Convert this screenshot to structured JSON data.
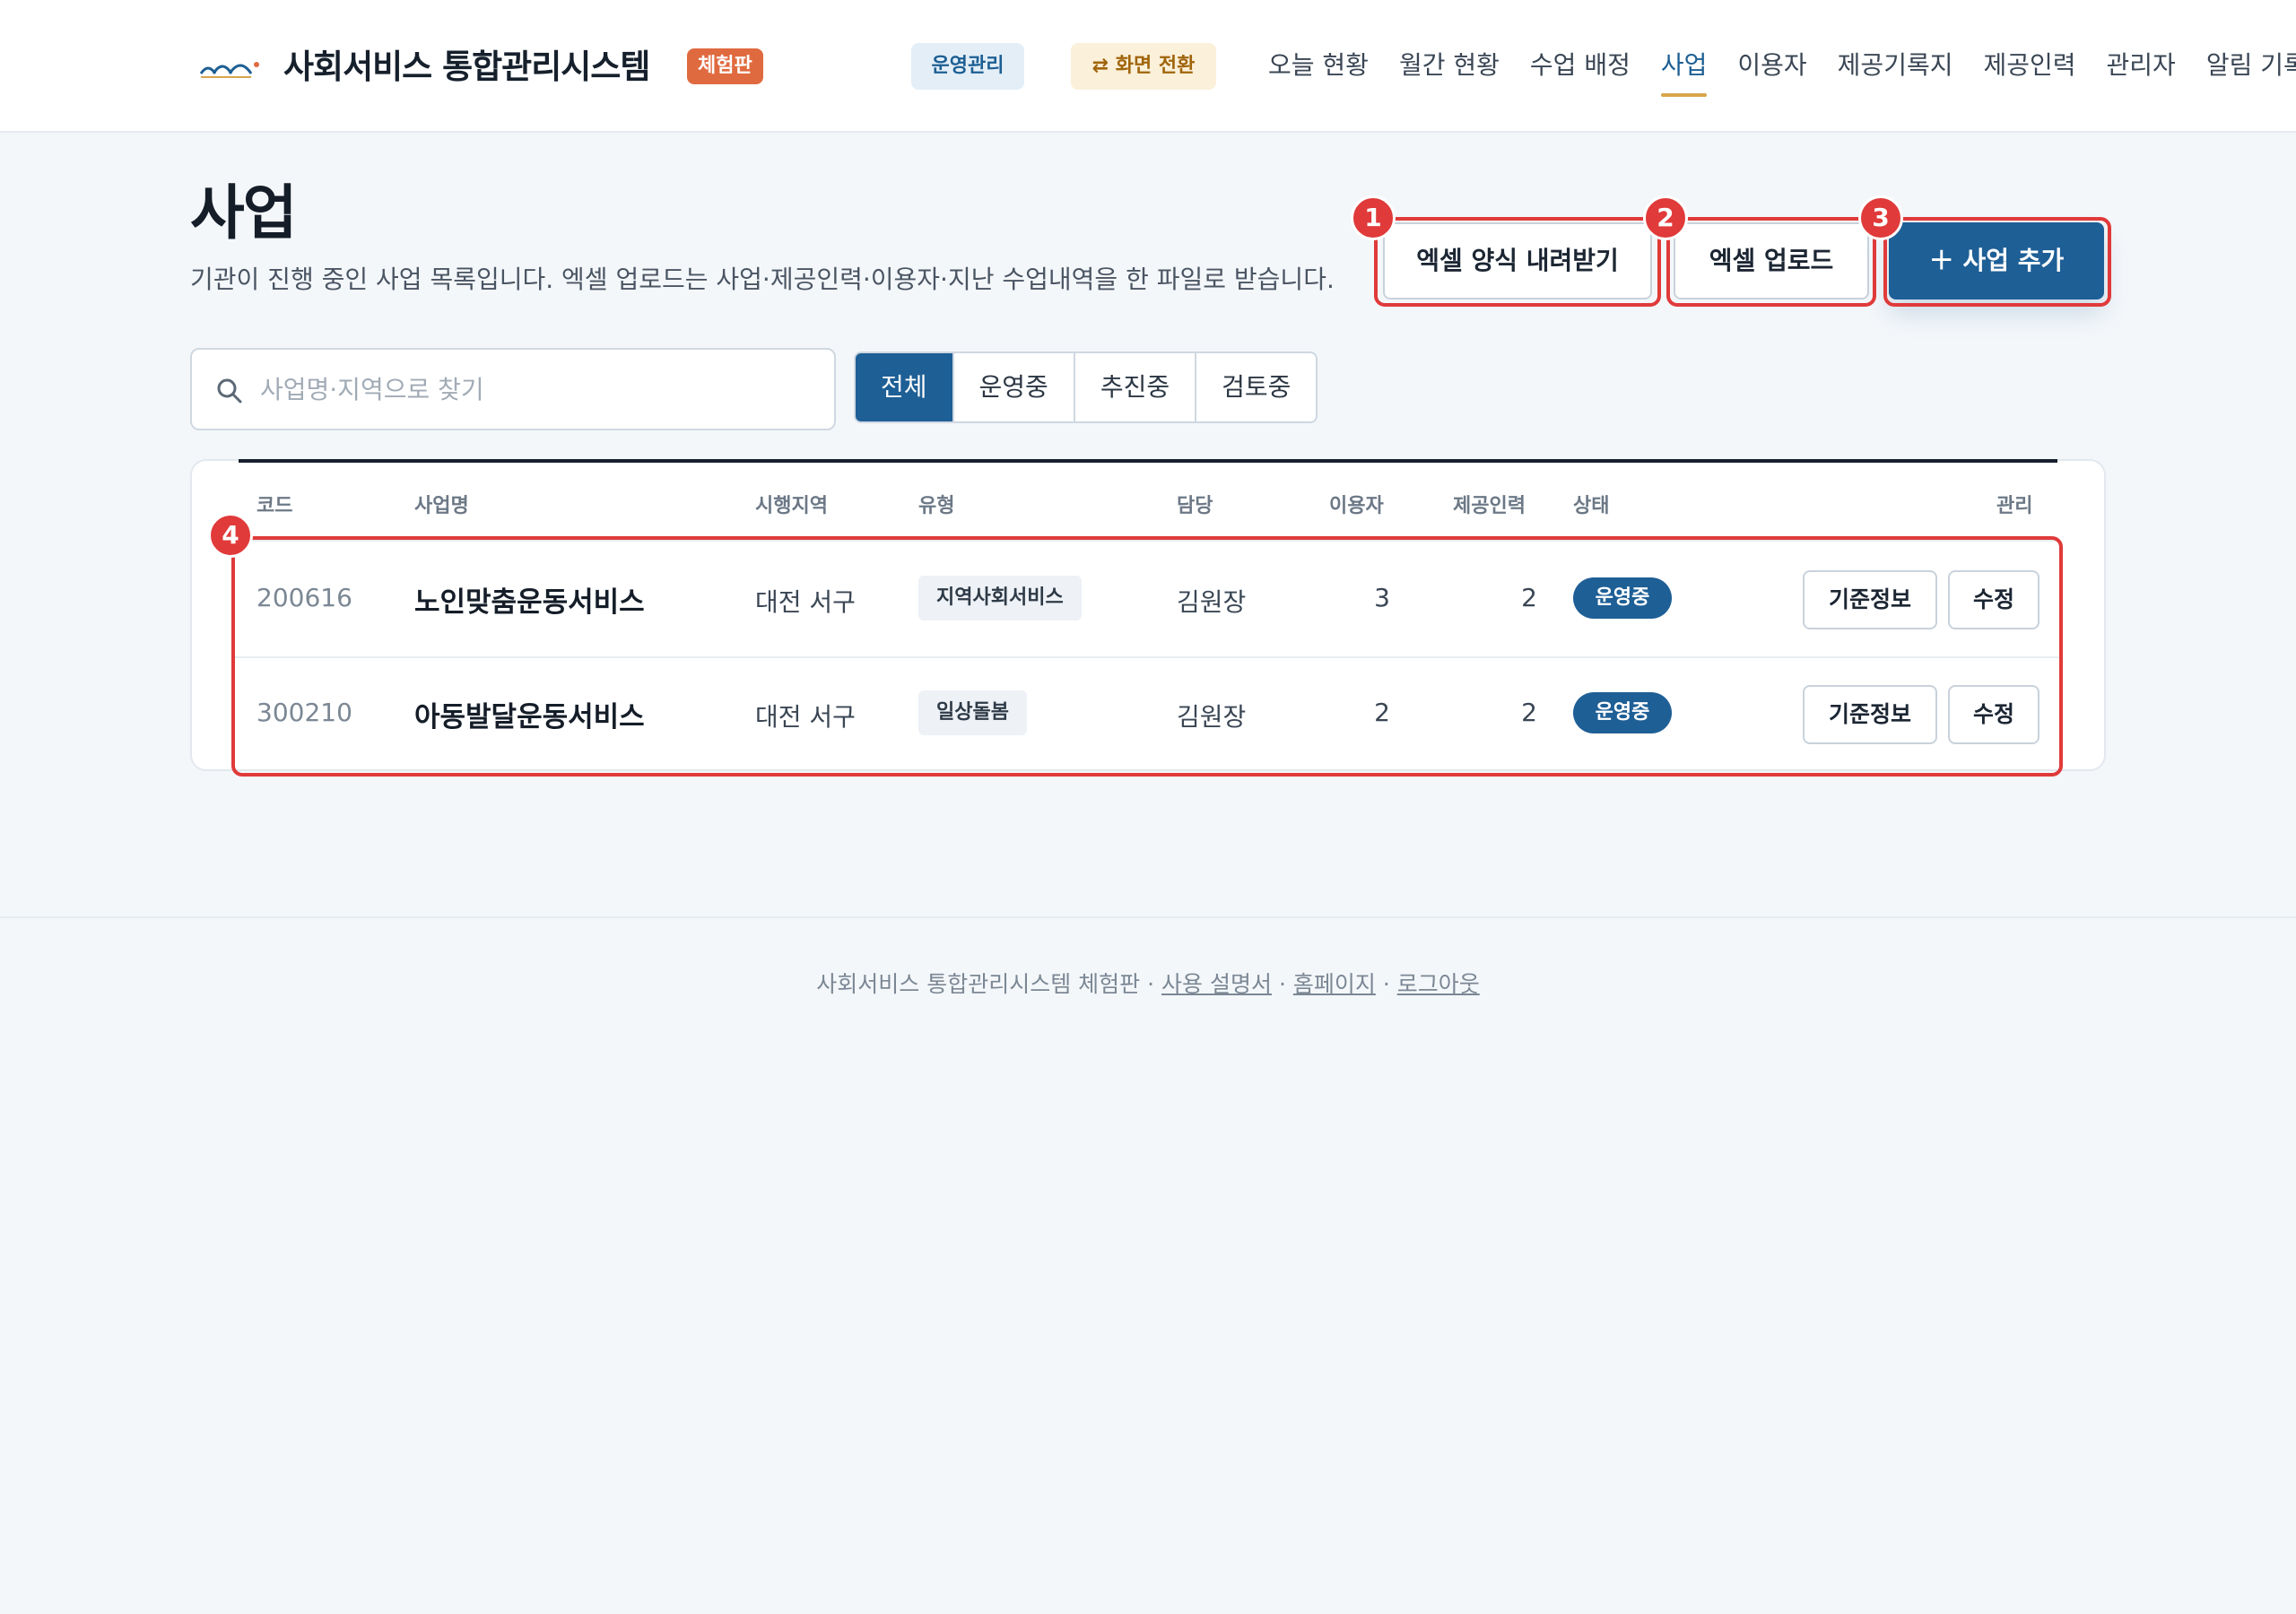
{
  "header": {
    "brand_title": "사회서비스 통합관리시스템",
    "edition_badge": "체험판",
    "ops_chip": "운영관리",
    "switch_chip": "⇄ 화면 전환",
    "nav": [
      "오늘 현황",
      "월간 현황",
      "수업 배정",
      "사업",
      "이용자",
      "제공기록지",
      "제공인력",
      "관리자",
      "알림 기록"
    ],
    "active_nav": "사업"
  },
  "page": {
    "title": "사업",
    "description": "기관이 진행 중인 사업 목록입니다. 엑셀 업로드는 사업·제공인력·이용자·지난 수업내역을 한 파일로 받습니다."
  },
  "actions": {
    "download_template": "엑셀 양식 내려받기",
    "upload": "엑셀 업로드",
    "add": "＋  사업 추가"
  },
  "markers": [
    "1",
    "2",
    "3",
    "4"
  ],
  "search": {
    "placeholder": "사업명·지역으로 찾기",
    "value": ""
  },
  "filters": {
    "tabs": [
      "전체",
      "운영중",
      "추진중",
      "검토중"
    ],
    "active": "전체"
  },
  "table": {
    "headers": {
      "code": "코드",
      "name": "사업명",
      "region": "시행지역",
      "type": "유형",
      "manager": "담당",
      "users": "이용자",
      "staff": "제공인력",
      "status": "상태",
      "manage": "관리"
    },
    "rows": [
      {
        "code": "200616",
        "name": "노인맞춤운동서비스",
        "region": "대전 서구",
        "type": "지역사회서비스",
        "manager": "김원장",
        "users": "3",
        "staff": "2",
        "status": "운영중",
        "btn_info": "기준정보",
        "btn_edit": "수정"
      },
      {
        "code": "300210",
        "name": "아동발달운동서비스",
        "region": "대전 서구",
        "type": "일상돌봄",
        "manager": "김원장",
        "users": "2",
        "staff": "2",
        "status": "운영중",
        "btn_info": "기준정보",
        "btn_edit": "수정"
      }
    ]
  },
  "footer": {
    "prefix": "사회서비스 통합관리시스템 체험판",
    "sep": "·",
    "links": [
      "사용 설명서",
      "홈페이지",
      "로그아웃"
    ]
  },
  "colors": {
    "primary": "#1e5f96",
    "highlight": "#e03a3a",
    "badge": "#e06a3f",
    "nav_underline": "#d7a64c"
  },
  "icons": {
    "logo": "arc-logo-icon",
    "search": "search-icon"
  }
}
